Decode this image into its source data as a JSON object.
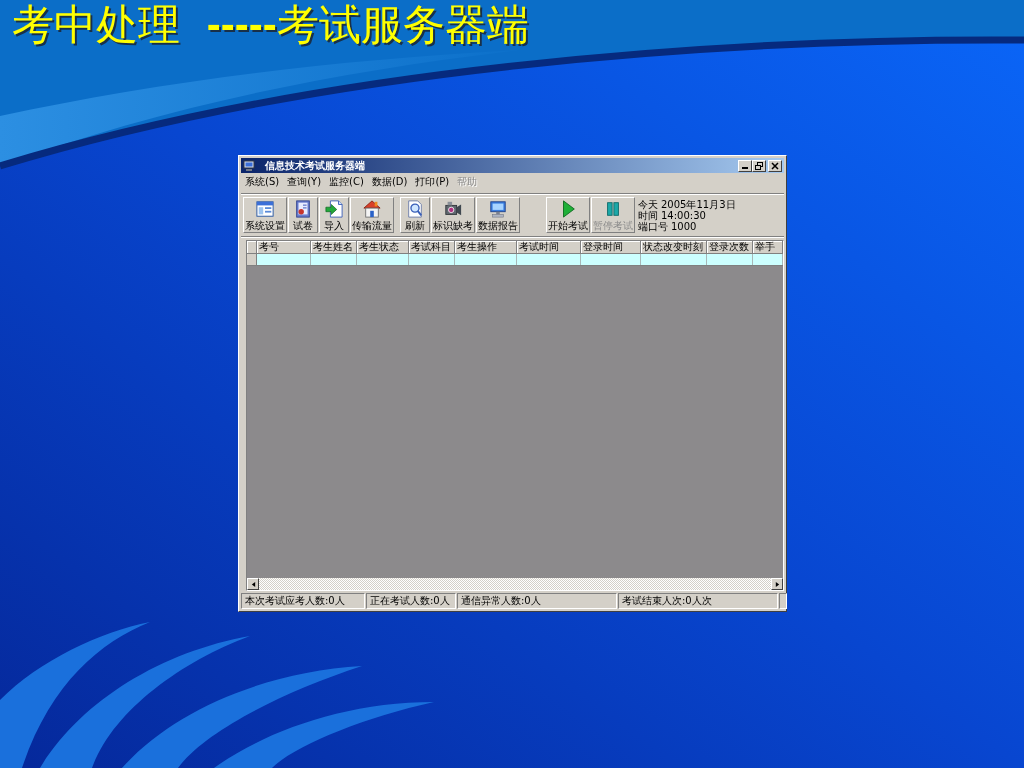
{
  "slide": {
    "title": "考中处理  **-----**考试服务器端"
  },
  "window": {
    "title": "信息技术考试服务器端",
    "menu": [
      {
        "label": "系统(S)",
        "disabled": false
      },
      {
        "label": "查询(Y)",
        "disabled": false
      },
      {
        "label": "监控(C)",
        "disabled": false
      },
      {
        "label": "数据(D)",
        "disabled": false
      },
      {
        "label": "打印(P)",
        "disabled": false
      },
      {
        "label": "帮助",
        "disabled": true
      }
    ],
    "toolbar_groups": [
      {
        "buttons": [
          {
            "kind": "settings",
            "label": "系统设置",
            "disabled": false
          },
          {
            "kind": "paper",
            "label": "试卷",
            "disabled": false
          },
          {
            "kind": "import",
            "label": "导入",
            "disabled": false
          },
          {
            "kind": "traffic",
            "label": "传输流量",
            "disabled": false
          }
        ]
      },
      {
        "buttons": [
          {
            "kind": "refresh",
            "label": "刷新",
            "disabled": false
          },
          {
            "kind": "absent",
            "label": "标识缺考",
            "disabled": false
          },
          {
            "kind": "report",
            "label": "数据报告",
            "disabled": false
          }
        ]
      },
      {
        "buttons": [
          {
            "kind": "start",
            "label": "开始考试",
            "disabled": false
          },
          {
            "kind": "pause",
            "label": "暂停考试",
            "disabled": true
          }
        ]
      }
    ],
    "info": [
      {
        "label": "今天",
        "value": "2005年11月3日"
      },
      {
        "label": "时间",
        "value": "14:00:30"
      },
      {
        "label": "端口号",
        "value": "1000"
      }
    ],
    "table": {
      "columns": [
        "考号",
        "考生姓名",
        "考生状态",
        "考试科目",
        "考生操作",
        "考试时间",
        "登录时间",
        "状态改变时刻",
        "登录次数",
        "举手"
      ]
    },
    "status_bar": [
      "本次考试应考人数:0人",
      "正在考试人数:0人",
      "通信异常人数:0人",
      "考试结束人次:0人次"
    ]
  }
}
